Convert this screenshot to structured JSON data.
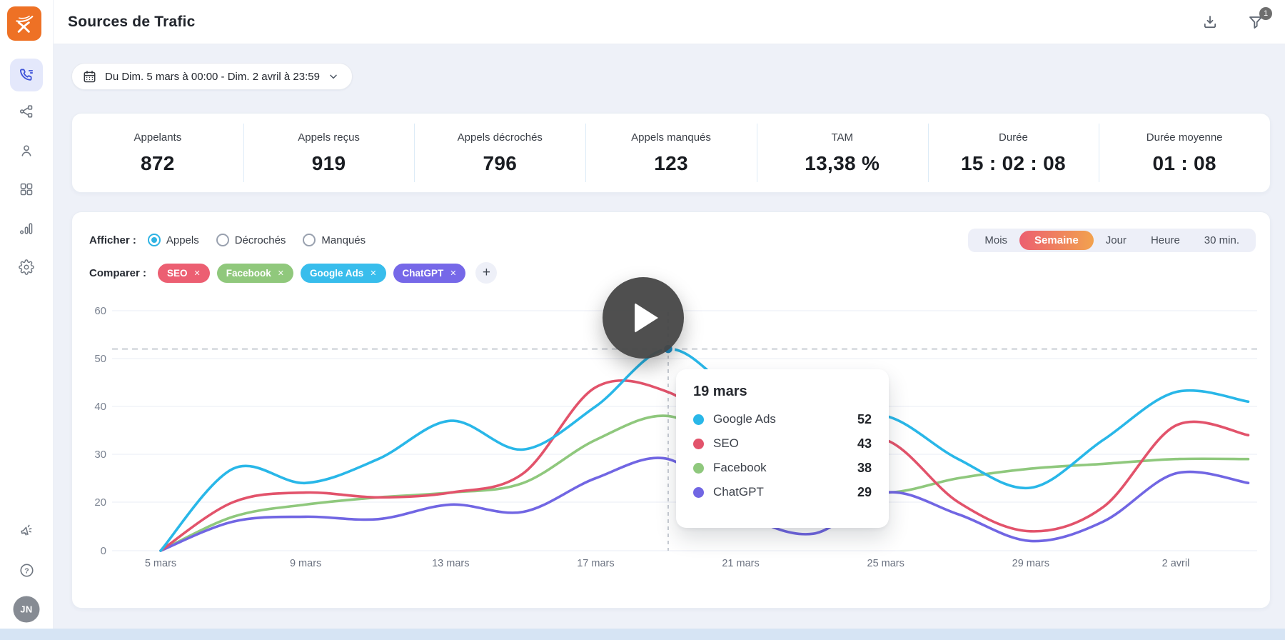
{
  "header": {
    "title": "Sources de Trafic",
    "filter_badge": "1"
  },
  "sidebar": {
    "avatar_initials": "JN"
  },
  "date_picker": {
    "label": "Du Dim. 5 mars à 00:00 - Dim. 2 avril à 23:59"
  },
  "stats": [
    {
      "label": "Appelants",
      "value": "872"
    },
    {
      "label": "Appels reçus",
      "value": "919"
    },
    {
      "label": "Appels décrochés",
      "value": "796"
    },
    {
      "label": "Appels manqués",
      "value": "123"
    },
    {
      "label": "TAM",
      "value": "13,38 %"
    },
    {
      "label": "Durée",
      "value": "15 : 02 : 08"
    },
    {
      "label": "Durée moyenne",
      "value": "01 : 08"
    }
  ],
  "chart_controls": {
    "afficher_label": "Afficher :",
    "radios": [
      {
        "label": "Appels",
        "selected": true
      },
      {
        "label": "Décrochés",
        "selected": false
      },
      {
        "label": "Manqués",
        "selected": false
      }
    ],
    "comparer_label": "Comparer :",
    "tags": [
      {
        "label": "SEO",
        "color": "#ec5f72"
      },
      {
        "label": "Facebook",
        "color": "#90c87c"
      },
      {
        "label": "Google Ads",
        "color": "#38bdec"
      },
      {
        "label": "ChatGPT",
        "color": "#7668e8"
      }
    ],
    "add_tag_label": "+",
    "period_tabs": [
      {
        "label": "Mois",
        "active": false
      },
      {
        "label": "Semaine",
        "active": true
      },
      {
        "label": "Jour",
        "active": false
      },
      {
        "label": "Heure",
        "active": false
      },
      {
        "label": "30 min.",
        "active": false
      }
    ]
  },
  "chart_data": {
    "type": "line",
    "title": "",
    "x": [
      "5 mars",
      "7 mars",
      "9 mars",
      "11 mars",
      "13 mars",
      "15 mars",
      "17 mars",
      "19 mars",
      "21 mars",
      "23 mars",
      "25 mars",
      "27 mars",
      "29 mars",
      "31 mars",
      "2 avril",
      "4 avril"
    ],
    "x_axis_labels": [
      "5 mars",
      "9 mars",
      "13 mars",
      "17 mars",
      "21 mars",
      "25 mars",
      "29 mars",
      "2 avril"
    ],
    "y_ticks": [
      0,
      20,
      30,
      40,
      50,
      60
    ],
    "ylim": [
      0,
      60
    ],
    "grid": "horizontal",
    "legend_position": "none",
    "series": [
      {
        "name": "Google Ads",
        "color": "#29b7e8",
        "values": [
          0,
          27,
          24,
          29,
          37,
          31,
          40,
          52,
          42,
          36,
          38,
          29,
          23,
          33,
          43,
          41
        ]
      },
      {
        "name": "SEO",
        "color": "#e2536b",
        "values": [
          0,
          20,
          22,
          21,
          22,
          26,
          44,
          43,
          33,
          30,
          33,
          20,
          8,
          18,
          36,
          34
        ]
      },
      {
        "name": "Facebook",
        "color": "#8fc87d",
        "values": [
          0,
          14,
          19,
          21,
          22,
          24,
          33,
          38,
          30,
          25,
          22,
          25,
          27,
          28,
          29,
          29
        ]
      },
      {
        "name": "ChatGPT",
        "color": "#7166e3",
        "values": [
          0,
          12,
          14,
          13,
          19,
          16,
          25,
          29,
          16,
          7,
          22,
          15,
          4,
          12,
          26,
          24
        ]
      }
    ],
    "highlight": {
      "x_label": "19 mars",
      "index": 7,
      "marker_series": "Google Ads",
      "marker_value": 52
    }
  },
  "tooltip": {
    "title": "19 mars",
    "rows": [
      {
        "name": "Google Ads",
        "value": "52",
        "color": "#29b7e8"
      },
      {
        "name": "SEO",
        "value": "43",
        "color": "#e2536b"
      },
      {
        "name": "Facebook",
        "value": "38",
        "color": "#8fc87d"
      },
      {
        "name": "ChatGPT",
        "value": "29",
        "color": "#7166e3"
      }
    ]
  }
}
